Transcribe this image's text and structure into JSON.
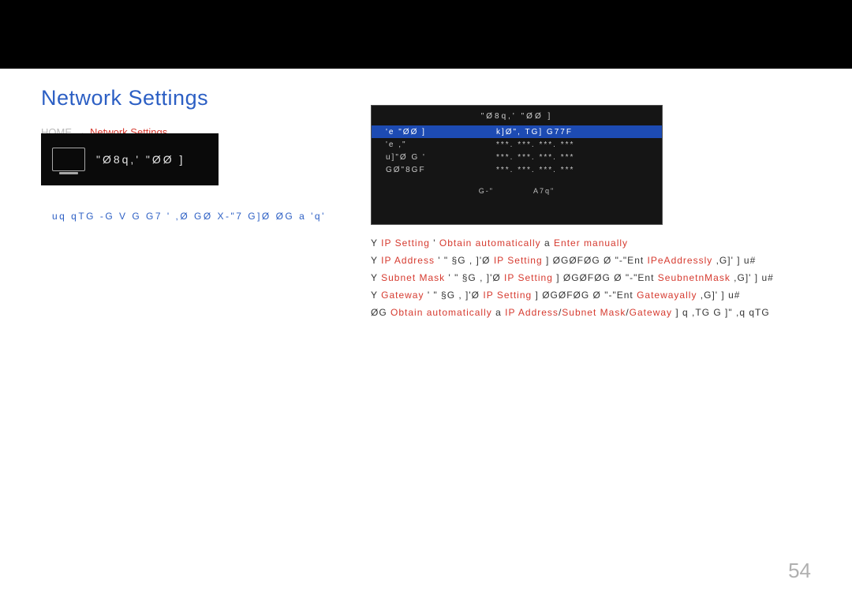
{
  "title": "Network Settings",
  "breadcrumb": {
    "home": "HOME",
    "network": "Network Settings",
    "rest": ""
  },
  "device": {
    "label": "\"Ø8q,'  \"ØØ ]"
  },
  "subnote": "uq  qTG    -G  V  G    G7    ' ,Ø    GØ   X-\"7   G]Ø    ØG  a  'q'",
  "osd": {
    "title": "\"Ø8q,'  \"ØØ ]",
    "rows": [
      {
        "label": "'e  \"ØØ ]",
        "value": "k]Ø\", TG] G77F",
        "highlight": true
      },
      {
        "label": "'e    ,\"",
        "value": "***. ***. ***. ***",
        "highlight": false
      },
      {
        "label": "u]\"Ø  G '",
        "value": "***. ***. ***. ***",
        "highlight": false
      },
      {
        "label": "GØ\"8GF",
        "value": "***. ***. ***. ***",
        "highlight": false
      }
    ],
    "footer": {
      "left": "G-\"",
      "right": "A7q\""
    }
  },
  "chap": [
    "",
    "",
    ""
  ],
  "instr": {
    "l1": {
      "pre": "Y  ",
      "r1": "IP Setting",
      "t1": " '  ",
      "r2": "Obtain automatically",
      "t2": " a ",
      "r3": "Enter manually"
    },
    "l2": {
      "pre": "Y  ",
      "r1": "IP Address",
      "t1": " '   \"       §G ,  ]'Ø    ",
      "r2": "IP Setting",
      "t2": " ]    ØGØFØG  Ø \"-\"Ent",
      "r3": "IPeAddressly",
      "t3": " ,G]'  ]      u#"
    },
    "l3": {
      "pre": "Y  ",
      "r1": "Subnet Mask",
      "t1": " '   \"       §G ,  ]'Ø    ",
      "r2": "IP Setting",
      "t2": " ]    ØGØFØG  Ø \"-\"Ent",
      "r3": "SeubnetnMask",
      "t3": " ,G]'  ]      u#"
    },
    "l4": {
      "pre": "Y  ",
      "r1": "Gateway",
      "t1": " '   \"       §G ,  ]'Ø    ",
      "r2": "IP Setting",
      "t2": " ]    ØGØFØG  Ø \"-\"Ent",
      "r3": "Gatewayally",
      "t3": ",G]'  ]      u#"
    },
    "l5": {
      "pre": "      ØG  ",
      "r1": "Obtain automatically",
      "t1": " a ",
      "r2": "IP Address",
      "r3": "Subnet Mask",
      "r4": "Gateway",
      "t2": "      ] q ,TG      G ]\" ,q  qTG"
    }
  },
  "page_number": "54"
}
